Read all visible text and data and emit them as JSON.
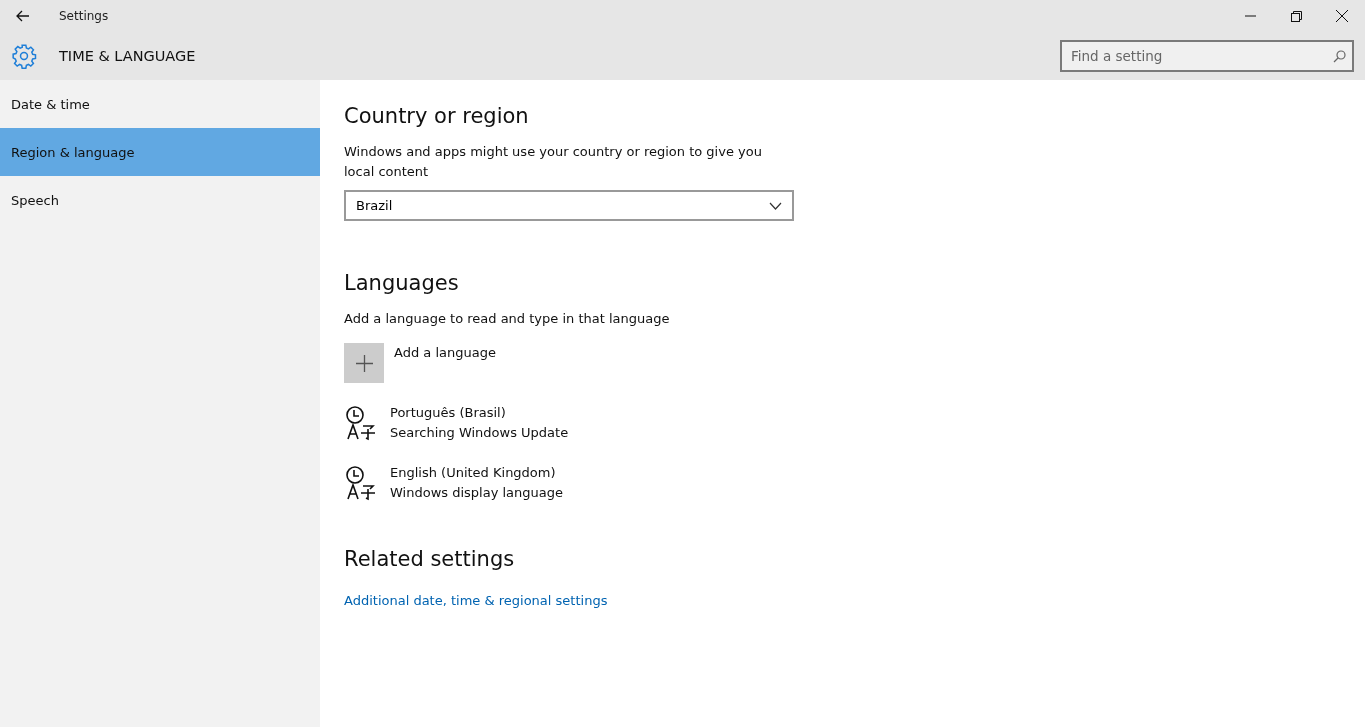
{
  "window": {
    "title": "Settings"
  },
  "header": {
    "title": "TIME & LANGUAGE",
    "search": {
      "placeholder": "Find a setting"
    }
  },
  "sidebar": {
    "items": [
      {
        "label": "Date & time",
        "selected": false
      },
      {
        "label": "Region & language",
        "selected": true
      },
      {
        "label": "Speech",
        "selected": false
      }
    ]
  },
  "country": {
    "heading": "Country or region",
    "description": "Windows and apps might use your country or region to give you local content",
    "value": "Brazil"
  },
  "languages": {
    "heading": "Languages",
    "description": "Add a language to read and type in that language",
    "add_label": "Add a language",
    "items": [
      {
        "name": "Português (Brasil)",
        "status": "Searching Windows Update"
      },
      {
        "name": "English (United Kingdom)",
        "status": "Windows display language"
      }
    ]
  },
  "related": {
    "heading": "Related settings",
    "link": "Additional date, time & regional settings"
  }
}
